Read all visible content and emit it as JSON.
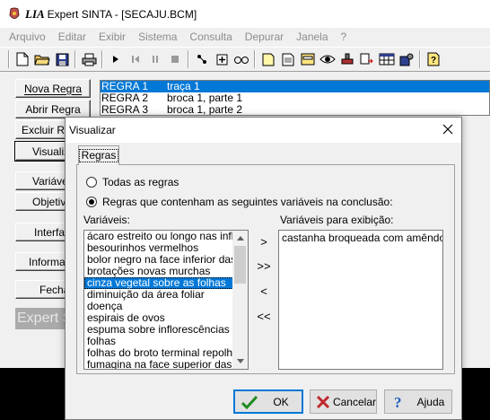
{
  "window": {
    "logo": "LIA",
    "title": "Expert SINTA - [SECAJU.BCM]"
  },
  "menu": [
    "Arquivo",
    "Editar",
    "Exibir",
    "Sistema",
    "Consulta",
    "Depurar",
    "Janela",
    "?"
  ],
  "toolbar_icons": [
    "new-file-icon",
    "open-folder-icon",
    "save-icon",
    "print-icon",
    "play-icon",
    "step-back-icon",
    "pause-icon",
    "stop-icon",
    "debug-icon",
    "add-icon",
    "watch-icon",
    "note-icon",
    "document-icon",
    "form-icon",
    "eye-icon",
    "stamp-icon",
    "export-icon",
    "table-icon",
    "settings-icon",
    "help-icon"
  ],
  "commands": {
    "nova_regra": "Nova Regra",
    "abrir_regra": "Abrir Regra",
    "excluir_regra": "Excluir Re",
    "visualizar": "Visualiz",
    "variaveis": "Variáve",
    "objetivos": "Objetiv",
    "interface": "Interfac",
    "informacoes": "Informaç",
    "fechar": "Fecha",
    "expert": "Expert S"
  },
  "rules": [
    {
      "id": "REGRA 1",
      "desc": "traça 1",
      "selected": true
    },
    {
      "id": "REGRA 2",
      "desc": "broca 1, parte 1",
      "selected": false
    },
    {
      "id": "REGRA 3",
      "desc": "broca 1, parte 2",
      "selected": false
    }
  ],
  "dialog": {
    "title": "Visualizar",
    "tab": "Regras",
    "radio_all": "Todas as regras",
    "radio_vars": "Regras que contenham as seguintes variáveis na conclusão:",
    "radio_vars_selected": true,
    "variables_label": "Variáveis:",
    "display_label": "Variáveis para exibição:",
    "variables": [
      "ácaro estreito ou longo nas inflores",
      "besourinhos vermelhos",
      "bolor negro na face inferior das foll",
      "brotações novas murchas",
      "cinza vegetal sobre as folhas",
      "diminuição da área foliar",
      "doença",
      "espirais de ovos",
      "espuma sobre inflorescências ou n",
      "folhas",
      "folhas do broto terminal repolhadas",
      "fumagina na face superior das folh"
    ],
    "selected_variable_index": 4,
    "display_variables": [
      "castanha broqueada com amêndoa to"
    ],
    "move_buttons": [
      ">",
      ">>",
      "<",
      "<<"
    ],
    "ok": "OK",
    "cancel": "Cancelar",
    "help": "Ajuda"
  },
  "colors": {
    "selection": "#0078d7",
    "menu_disabled": "#8c8c8c"
  }
}
